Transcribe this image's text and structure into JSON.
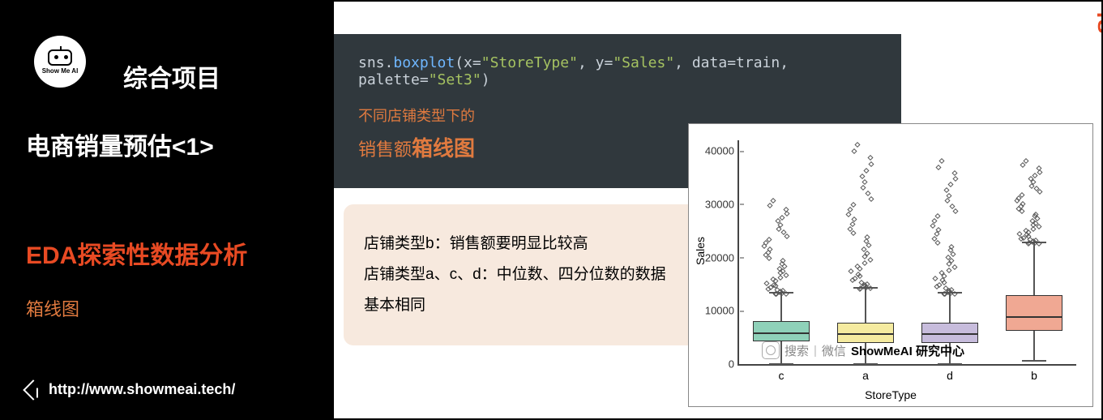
{
  "logo": {
    "text": "Show Me AI"
  },
  "left": {
    "project_label": "综合项目",
    "main_title": "电商销量预估<1>",
    "subtitle_red": "EDA探索性数据分析",
    "small_label": "箱线图",
    "site_url": "http://www.showmeai.tech/"
  },
  "code": {
    "prefix": "sns.",
    "fn": "boxplot",
    "body": "(x=\"StoreType\", y=\"Sales\", data=train, palette=\"Set3\")"
  },
  "caption": {
    "line1": "不同店铺类型下的",
    "line2_a": "销售额",
    "line2_b": "箱线图"
  },
  "bubble": {
    "line1": "店铺类型b：销售额要明显比较高",
    "line2": "店铺类型a、c、d：中位数、四分位数的数据基本相同"
  },
  "watermark": {
    "pre": "搜索",
    "mid": "微信",
    "brand": "ShowMeAI 研究中心"
  },
  "side_brand": {
    "a": "Show",
    "b": "MeAI"
  },
  "chart_data": {
    "type": "boxplot",
    "xlabel": "StoreType",
    "ylabel": "Sales",
    "ylim": [
      0,
      42000
    ],
    "yticks": [
      0,
      10000,
      20000,
      30000,
      40000
    ],
    "categories": [
      "c",
      "a",
      "d",
      "b"
    ],
    "colors": [
      "#8fd1b9",
      "#f5eba0",
      "#c7bcdc",
      "#f0a893"
    ],
    "series": [
      {
        "name": "c",
        "q1": 4200,
        "median": 6000,
        "q3": 8000,
        "whisker_low": 100,
        "whisker_high": 13500,
        "outlier_max": 31000
      },
      {
        "name": "a",
        "q1": 4000,
        "median": 5800,
        "q3": 7800,
        "whisker_low": 100,
        "whisker_high": 14500,
        "outlier_max": 41500
      },
      {
        "name": "d",
        "q1": 4000,
        "median": 5800,
        "q3": 7800,
        "whisker_low": 100,
        "whisker_high": 13500,
        "outlier_max": 38500
      },
      {
        "name": "b",
        "q1": 6200,
        "median": 9000,
        "q3": 13000,
        "whisker_low": 700,
        "whisker_high": 23000,
        "outlier_max": 38500
      }
    ]
  }
}
